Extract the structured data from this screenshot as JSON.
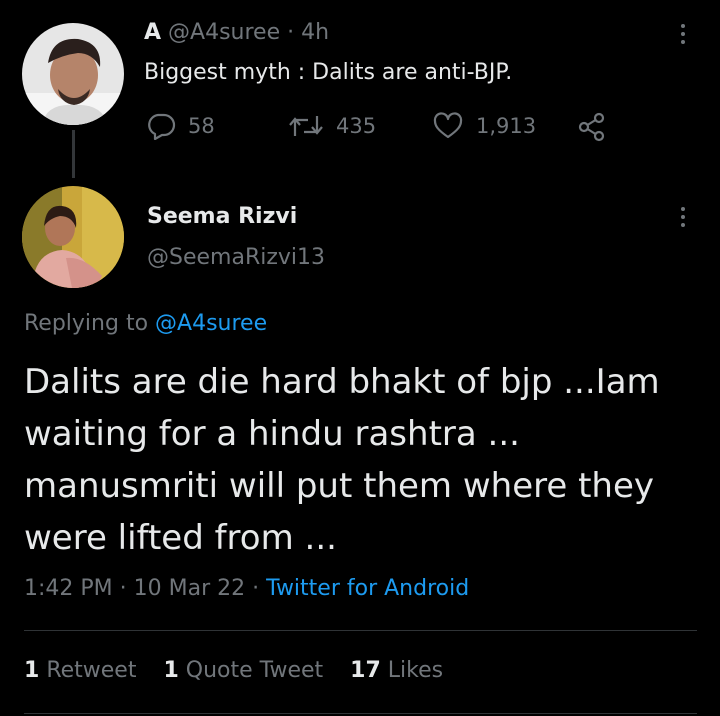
{
  "parent_tweet": {
    "author_name": "A",
    "author_handle": "@A4suree",
    "separator": "·",
    "time_ago": "4h",
    "text": "Biggest myth : Dalits are anti-BJP.",
    "replies": "58",
    "retweets": "435",
    "likes": "1,913",
    "icons": [
      "reply-icon",
      "retweet-icon",
      "like-icon",
      "share-icon",
      "more-icon"
    ]
  },
  "main_tweet": {
    "author_name": "Seema Rizvi",
    "author_handle": "@SeemaRizvi13",
    "replying_prefix": "Replying to",
    "replying_to": "@A4suree",
    "text_lines": [
      "Dalits are die hard bhakt of bjp ...Iam",
      "waiting for a hindu rashtra ...",
      "manusmriti will put them where they",
      "were lifted from ..."
    ],
    "time": "1:42 PM",
    "date": "10 Mar 22",
    "separator": "·",
    "source": "Twitter for Android",
    "stats": {
      "retweets_count": "1",
      "retweets_label": "Retweet",
      "quotes_count": "1",
      "quotes_label": "Quote Tweet",
      "likes_count": "17",
      "likes_label": "Likes"
    }
  },
  "colors": {
    "background": "#000000",
    "text": "#e7e9ea",
    "muted": "#71767b",
    "link": "#1d9bf0",
    "divider": "#2f3336"
  }
}
